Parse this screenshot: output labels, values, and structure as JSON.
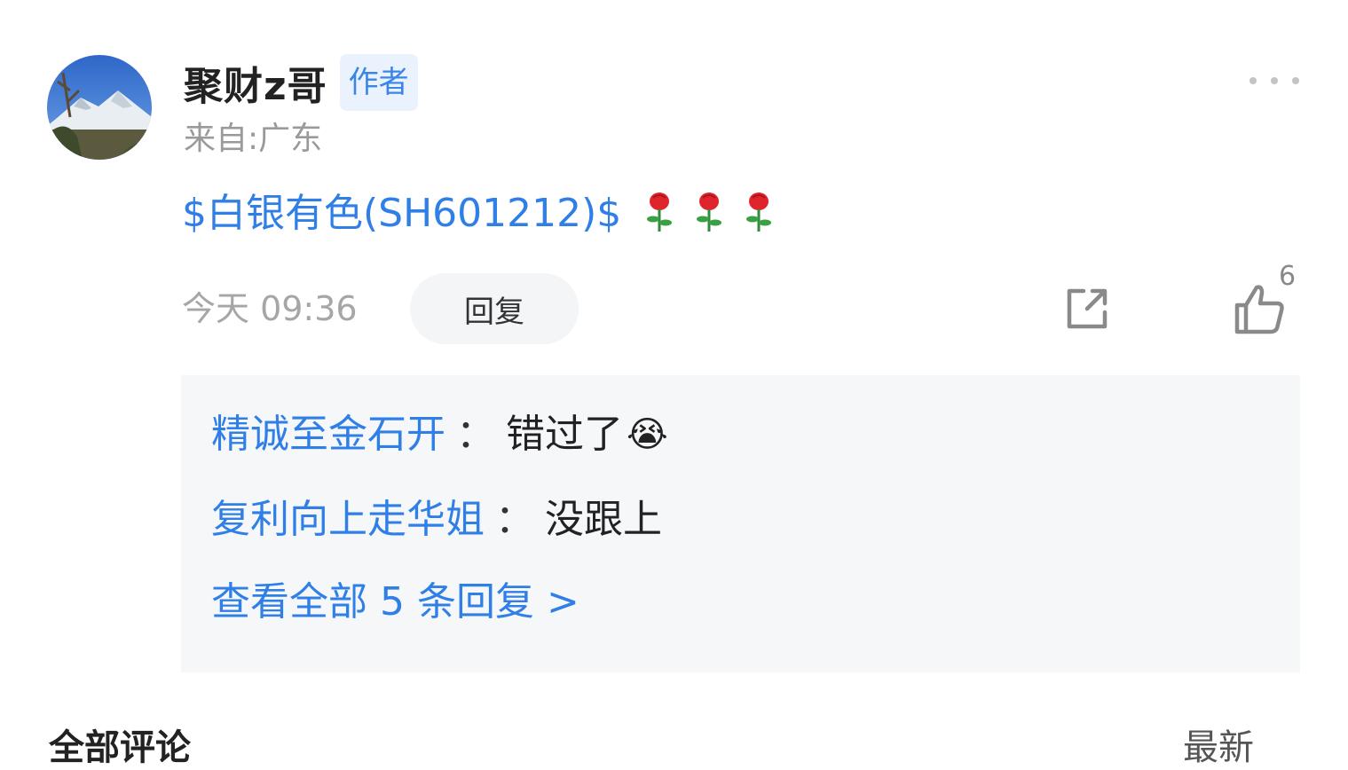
{
  "comment": {
    "username": "聚财z哥",
    "author_badge": "作者",
    "location": "来自:广东",
    "content_link": "$白银有色(SH601212)$",
    "emoji": [
      "🌹",
      "🌹",
      "🌹"
    ],
    "time": "今天 09:36",
    "reply_label": "回复",
    "like_count": "6"
  },
  "replies": {
    "items": [
      {
        "user": "精诚至金石开",
        "separator": "：",
        "text": "错过了",
        "emoji": "😭"
      },
      {
        "user": "复利向上走华姐",
        "separator": "：",
        "text": "没跟上"
      }
    ],
    "view_all": "查看全部 5 条回复 >"
  },
  "footer": {
    "left_label": "全部评论",
    "right_label": "最新"
  },
  "icons": {
    "more": "more-dots-icon",
    "share": "share-icon",
    "like": "thumbs-up-icon"
  },
  "colors": {
    "link_blue": "#2f7fe6",
    "badge_bg": "#e9f2fd",
    "reply_box_bg": "#f5f7f9"
  }
}
